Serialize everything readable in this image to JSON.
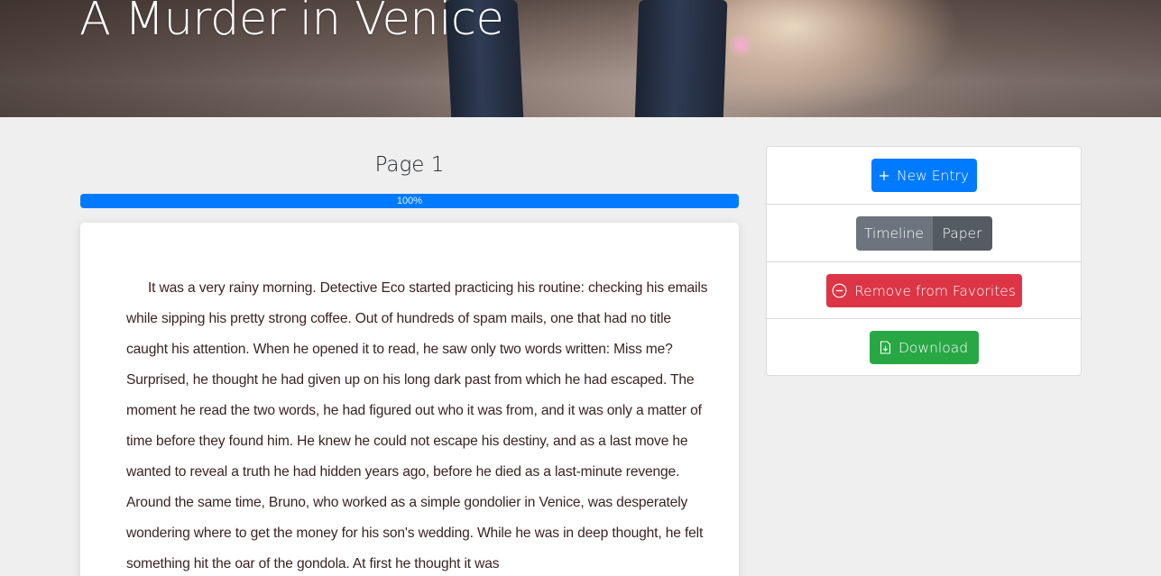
{
  "story": {
    "title": "A Murder in Venice",
    "page_label": "Page 1",
    "progress_percent": 100,
    "progress_label": "100%",
    "text": "It was a very rainy morning. Detective Eco started practicing his routine: checking his emails while sipping his pretty strong coffee. Out of hundreds of spam mails, one that had no title caught his attention. When he opened it to read, he saw only two words written: Miss me? Surprised, he thought he had given up on his long dark past from which he had escaped. The moment he read the two words, he had figured out who it was from, and it was only a matter of time before they found him. He knew he could not escape his destiny, and as a last move he wanted to reveal a truth he had hidden years ago, before he died as a last-minute revenge. Around the same time, Bruno, who worked as a simple gondolier in Venice, was desperately wondering where to get the money for his son's wedding. While he was in deep thought, he felt something hit the oar of the gondola. At first he thought it was"
  },
  "sidebar": {
    "new_entry_label": "New Entry",
    "new_entry_icon": "plus-icon",
    "view_toggle": {
      "timeline_label": "Timeline",
      "paper_label": "Paper",
      "active": "Paper"
    },
    "favorite_label": "Remove from Favorites",
    "favorite_icon": "minus-circle-icon",
    "download_label": "Download",
    "download_icon": "file-download-icon"
  },
  "colors": {
    "primary": "#007bff",
    "danger": "#dc3545",
    "success": "#28a745",
    "secondary": "#6c757d",
    "secondary_active": "#545b62",
    "background": "#efefef"
  }
}
